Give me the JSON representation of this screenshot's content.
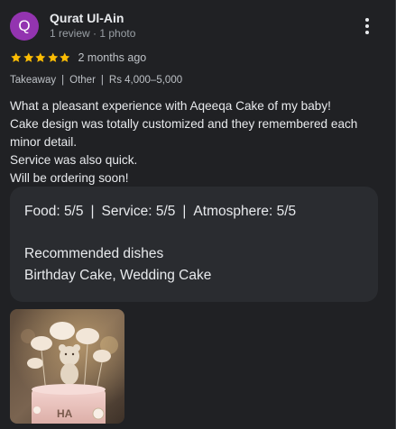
{
  "reviewer": {
    "initial": "Q",
    "name": "Qurat Ul-Ain",
    "meta": "1 review · 1 photo",
    "avatar_color": "#9334b0"
  },
  "more_icon": "more-vert-icon",
  "rating": {
    "stars": 5,
    "star_color": "#fbbc04",
    "date": "2 months ago"
  },
  "tags": {
    "service_type": "Takeaway",
    "category": "Other",
    "price": "Rs 4,000–5,000"
  },
  "review_lines": [
    "What a pleasant experience with Aqeeqa Cake of my baby!",
    "Cake design was totally customized and they remembered each",
    "minor detail.",
    "Service was also quick.",
    "Will be ordering soon!"
  ],
  "details": {
    "food": "Food: 5/5",
    "service": "Service: 5/5",
    "atmosphere": "Atmosphere: 5/5",
    "separator": "|",
    "recommended_heading": "Recommended dishes",
    "recommended_dishes": "Birthday Cake, Wedding Cake"
  },
  "photo": {
    "cake_text": "HA"
  },
  "colors": {
    "background": "#202124",
    "card": "#2a2c30",
    "text": "#e8eaed",
    "secondary_text": "#9aa0a6"
  }
}
